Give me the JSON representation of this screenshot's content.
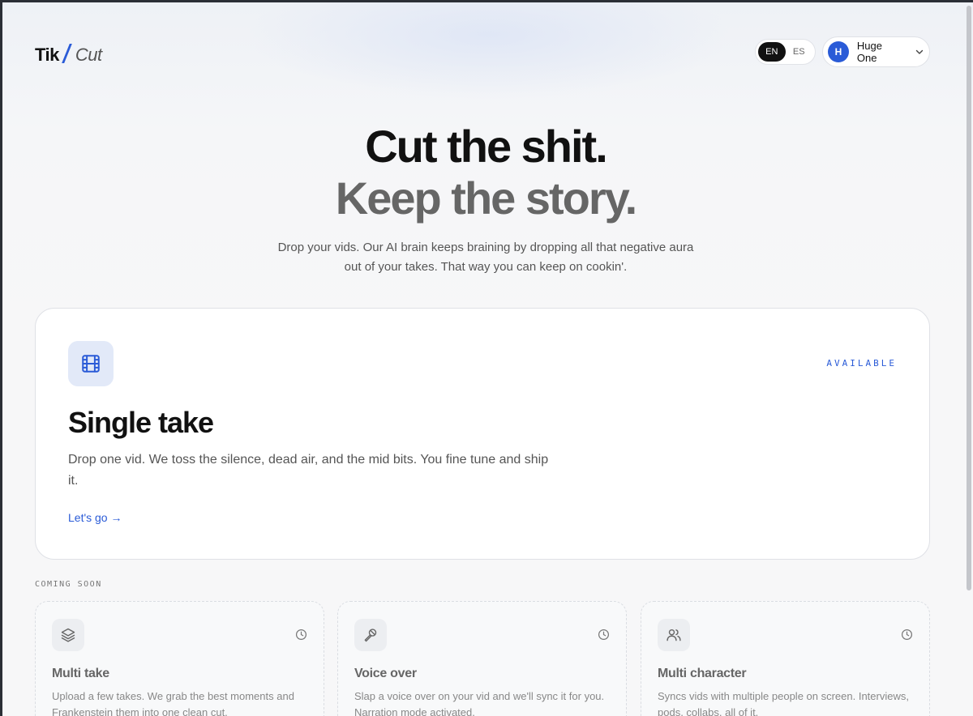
{
  "brand": {
    "tik": "Tik",
    "cut": "Cut",
    "accent": "#2a5bd7"
  },
  "language": {
    "options": [
      "EN",
      "ES"
    ],
    "selected": "EN"
  },
  "user": {
    "initial": "H",
    "name": "Huge One"
  },
  "hero": {
    "line1": "Cut the shit.",
    "line2": "Keep the story.",
    "subtitle": "Drop your vids. Our AI brain keeps braining by dropping all that negative aura out of your takes. That way you can keep on cookin'."
  },
  "main_card": {
    "icon": "film-icon",
    "status": "AVAILABLE",
    "title": "Single take",
    "description": "Drop one vid. We toss the silence, dead air, and the mid bits. You fine tune and ship it.",
    "link": "Let's go →"
  },
  "coming_soon": {
    "label": "COMING SOON",
    "cards": [
      {
        "icon": "layers-icon",
        "title": "Multi take",
        "description": "Upload a few takes. We grab the best moments and Frankenstein them into one clean cut."
      },
      {
        "icon": "microphone-icon",
        "title": "Voice over",
        "description": "Slap a voice over on your vid and we'll sync it for you. Narration mode activated."
      },
      {
        "icon": "users-icon",
        "title": "Multi character",
        "description": "Syncs vids with multiple people on screen. Interviews, pods, collabs, all of it."
      }
    ]
  }
}
